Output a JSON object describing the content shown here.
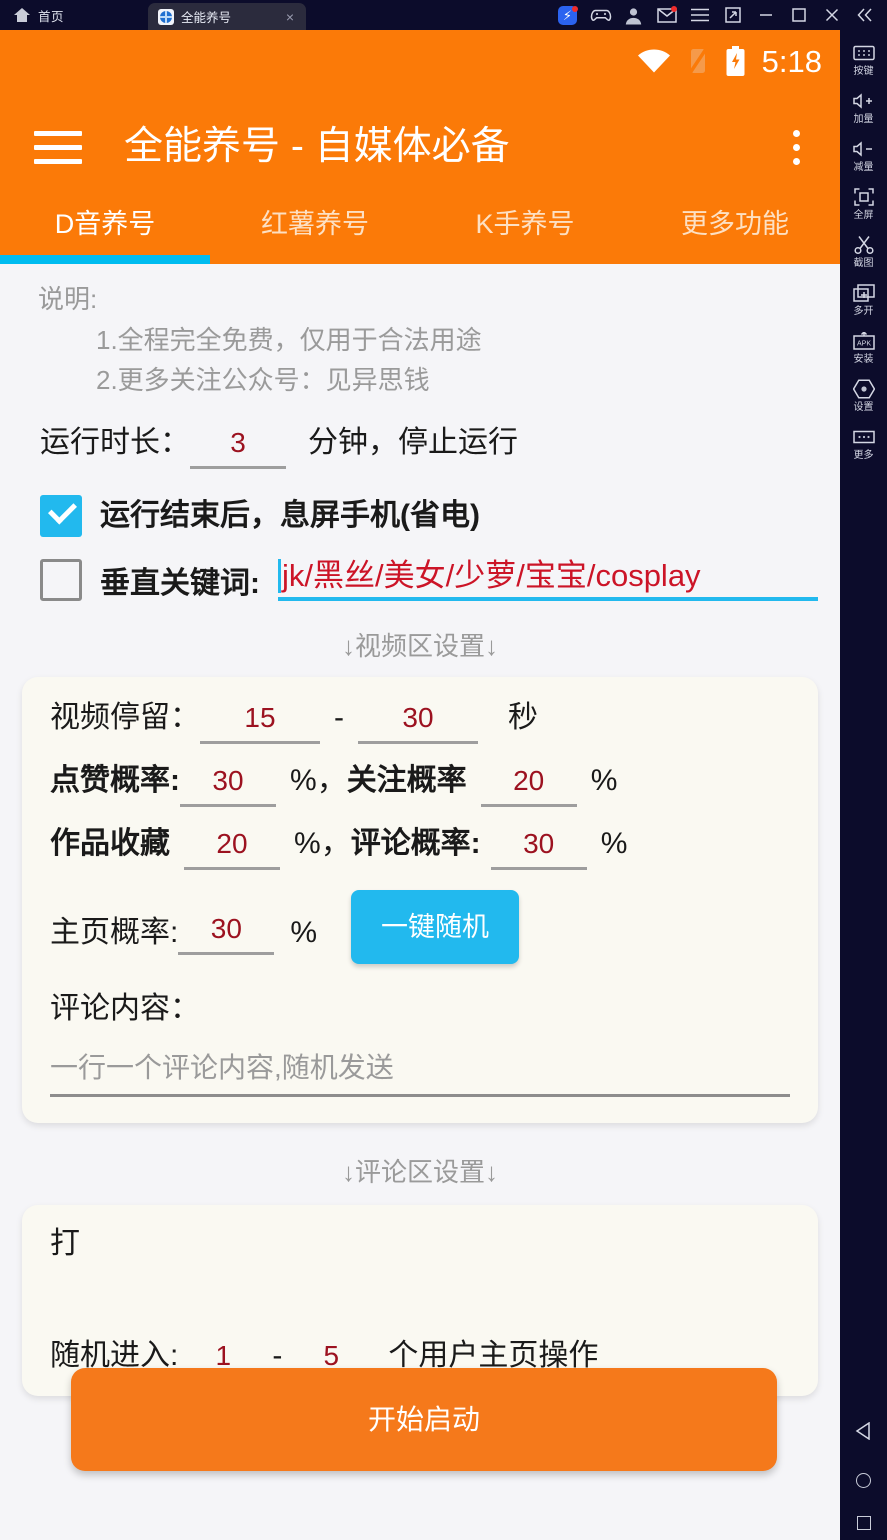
{
  "window": {
    "home_label": "首页",
    "tab_title": "全能养号",
    "tab_close": "×",
    "controls": [
      {
        "name": "boost-icon",
        "glyph": "⚡",
        "badge": true
      },
      {
        "name": "gamepad-icon",
        "glyph": "",
        "badge": false
      },
      {
        "name": "account-avatar-icon",
        "glyph": "",
        "badge": false
      },
      {
        "name": "mail-icon",
        "glyph": "",
        "badge": true
      },
      {
        "name": "menu-icon",
        "glyph": "",
        "badge": false
      },
      {
        "name": "restore-window-icon",
        "glyph": "",
        "badge": false
      },
      {
        "name": "minimize-window-icon",
        "glyph": "",
        "badge": false
      },
      {
        "name": "maximize-window-icon",
        "glyph": "",
        "badge": false
      },
      {
        "name": "close-window-icon",
        "glyph": "",
        "badge": false
      },
      {
        "name": "collapse-rail-icon",
        "glyph": "",
        "badge": false
      }
    ]
  },
  "rail": {
    "items": [
      {
        "icon": "keyboard-icon",
        "label": "按键"
      },
      {
        "icon": "volume-up-icon",
        "label": "加量"
      },
      {
        "icon": "volume-down-icon",
        "label": "减量"
      },
      {
        "icon": "fullscreen-icon",
        "label": "全屏"
      },
      {
        "icon": "scissors-icon",
        "label": "截图"
      },
      {
        "icon": "multi-instance-icon",
        "label": "多开"
      },
      {
        "icon": "apk-install-icon",
        "label": "安装"
      },
      {
        "icon": "gear-icon",
        "label": "设置"
      },
      {
        "icon": "more-icon",
        "label": "更多"
      }
    ],
    "nav": [
      {
        "icon": "nav-back-icon"
      },
      {
        "icon": "nav-home-icon"
      },
      {
        "icon": "nav-recents-icon"
      }
    ]
  },
  "statusbar": {
    "wifi_icon": "wifi-icon",
    "signal_icon": "signal-off-icon",
    "battery_icon": "battery-charging-icon",
    "clock": "5:18"
  },
  "appbar": {
    "menu_icon": "hamburger-icon",
    "title": "全能养号 - 自媒体必备",
    "overflow_icon": "kebab-menu-icon"
  },
  "tabs": {
    "items": [
      {
        "label": "D音养号",
        "active": true
      },
      {
        "label": "红薯养号",
        "active": false
      },
      {
        "label": "K手养号",
        "active": false
      },
      {
        "label": "更多功能",
        "active": false
      }
    ],
    "indicator_color": "#00bcf0"
  },
  "notes": {
    "title": "说明:",
    "lines": [
      "1.全程完全免费，仅用于合法用途",
      "2.更多关注公众号：见异思钱"
    ]
  },
  "duration": {
    "label": "运行时长：",
    "value": "3",
    "suffix": "分钟，停止运行"
  },
  "sleep_option": {
    "checked": true,
    "label": "运行结束后，息屏手机(省电)"
  },
  "keyword_option": {
    "checked": false,
    "label": "垂直关键词:",
    "value": "jk/黑丝/美女/少萝/宝宝/cosplay"
  },
  "video_section": {
    "heading": "↓视频区设置↓",
    "stay": {
      "label": "视频停留：",
      "min": "15",
      "sep": "-",
      "max": "30",
      "unit": "秒"
    },
    "like": {
      "label": "点赞概率:",
      "value": "30",
      "unit": "%",
      "comma": "，",
      "label2": "关注概率",
      "value2": "20",
      "unit2": "%"
    },
    "collect": {
      "label": "作品收藏",
      "value": "20",
      "unit": "%",
      "comma": "，",
      "label2": "评论概率:",
      "value2": "30",
      "unit2": "%"
    },
    "homepage": {
      "label": "主页概率:",
      "value": "30",
      "unit": "%",
      "random_button": "一键随机"
    },
    "comment": {
      "label": "评论内容：",
      "placeholder": "一行一个评论内容,随机发送"
    }
  },
  "comment_section": {
    "heading": "↓评论区设置↓",
    "open_label": "打",
    "enter": {
      "label": "随机进入:",
      "min": "1",
      "sep": "-",
      "max": "5",
      "suffix": "个用户主页操作"
    }
  },
  "start_button": {
    "label": "开始启动"
  },
  "colors": {
    "brand_orange": "#fb7a08",
    "start_orange": "#f5791b",
    "accent_cyan": "#22b9ee",
    "value_red": "#9c1220",
    "keyword_red": "#cc1427",
    "page_bg": "#f5f5f8",
    "card_bg": "#faf9f2",
    "chrome_navy": "#0c0c2b"
  }
}
